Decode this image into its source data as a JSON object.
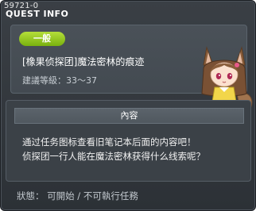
{
  "window": {
    "quest_code": "59721-0",
    "title": "QUEST INFO"
  },
  "quest": {
    "category_badge": "一般",
    "title": "[橡果侦探团]魔法密林的痕迹",
    "level_range": "建議等級：33～37",
    "portrait_icon": "fox-eared-girl-portrait"
  },
  "content": {
    "header": "內容",
    "lines": [
      "通过任务图标查看旧笔记本后面的内容吧！",
      "侦探团一行人能在魔法密林获得什么线索呢？"
    ]
  },
  "status": {
    "text": "狀態： 可開始 / 不可執行任務"
  },
  "colors": {
    "badge_green": "#8cc21a",
    "panel_bg": "#434a51",
    "window_bg": "#2f3439"
  }
}
